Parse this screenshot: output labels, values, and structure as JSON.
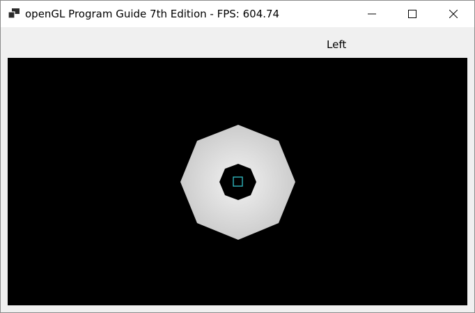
{
  "window": {
    "title": "openGL Program Guide 7th Edition - FPS: 604.74",
    "icon": "app-window-icon",
    "controls": {
      "minimize_icon": "minimize-icon",
      "maximize_icon": "maximize-icon",
      "close_icon": "close-icon"
    }
  },
  "toolbar": {
    "label": "Left"
  },
  "scene": {
    "background_color": "#000000",
    "outer_octagon_color": "#d6d6d6",
    "inner_octagon_color": "#000000",
    "center_square_color": "#33c3cc"
  }
}
